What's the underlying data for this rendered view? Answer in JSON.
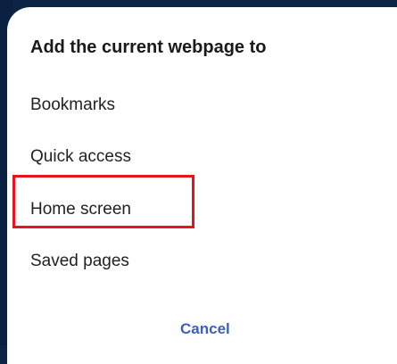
{
  "dialog": {
    "title": "Add the current webpage to",
    "options": [
      {
        "label": "Bookmarks"
      },
      {
        "label": "Quick access"
      },
      {
        "label": "Home screen",
        "highlighted": true
      },
      {
        "label": "Saved pages"
      }
    ],
    "cancel_label": "Cancel"
  },
  "colors": {
    "backdrop": "#0d2444",
    "dialog_background": "#ffffff",
    "highlight_border": "#e8141c",
    "cancel_text": "#3f5fb8"
  }
}
